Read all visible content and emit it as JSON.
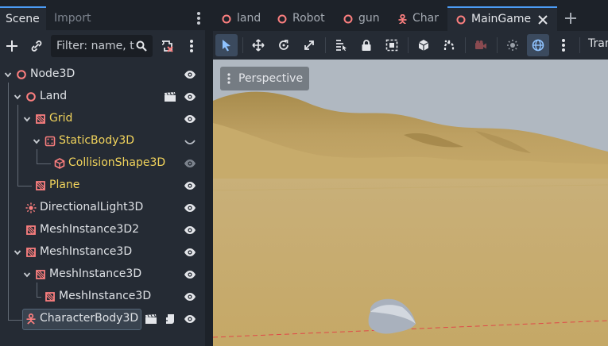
{
  "dock": {
    "tabs": {
      "scene": "Scene",
      "import": "Import"
    },
    "filter_placeholder": "Filter: name, t:"
  },
  "tree": [
    {
      "label": "Node3D",
      "color": "white",
      "icon": "node3d-icon"
    },
    {
      "label": "Land",
      "color": "white",
      "icon": "node3d-icon",
      "extra": "clapperboard-icon"
    },
    {
      "label": "Grid",
      "color": "yellow",
      "icon": "mesh-instance-icon"
    },
    {
      "label": "StaticBody3D",
      "color": "yellow",
      "icon": "static-body-icon",
      "visibility": "collapsed"
    },
    {
      "label": "CollisionShape3D",
      "color": "yellow",
      "icon": "collision-shape-icon",
      "visibility": "dim"
    },
    {
      "label": "Plane",
      "color": "yellow",
      "icon": "mesh-instance-icon"
    },
    {
      "label": "DirectionalLight3D",
      "color": "white",
      "icon": "sun-icon"
    },
    {
      "label": "MeshInstance3D2",
      "color": "white",
      "icon": "mesh-instance-icon"
    },
    {
      "label": "MeshInstance3D",
      "color": "white",
      "icon": "mesh-instance-icon"
    },
    {
      "label": "MeshInstance3D",
      "color": "white",
      "icon": "mesh-instance-icon"
    },
    {
      "label": "MeshInstance3D",
      "color": "white",
      "icon": "mesh-instance-icon"
    },
    {
      "label": "CharacterBody3D",
      "color": "white",
      "icon": "character-body-icon",
      "selected": true
    }
  ],
  "scene_tabs": [
    {
      "label": "land",
      "icon": "node3d-icon"
    },
    {
      "label": "Robot",
      "icon": "node3d-icon"
    },
    {
      "label": "gun",
      "icon": "node3d-icon"
    },
    {
      "label": "Char",
      "icon": "character-body-icon"
    },
    {
      "label": "MainGame",
      "icon": "node3d-icon",
      "active": true
    }
  ],
  "viewport": {
    "perspective_label": "Perspective",
    "toolbar_trailing_label": "Tran"
  },
  "colors": {
    "accent": "#4c9cf5",
    "node_icon": "#fc7f7f",
    "yellow_text": "#f2d45c",
    "sky": "#aab3bd",
    "sand": "#c4ab6c"
  }
}
